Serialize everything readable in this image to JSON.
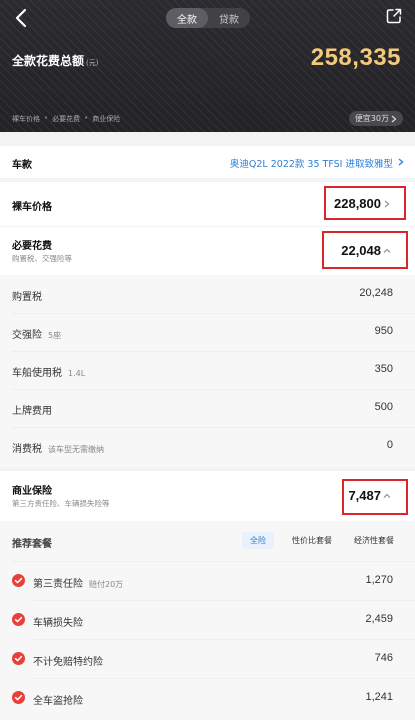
{
  "header": {
    "tabs": [
      {
        "label": "全款",
        "active": true
      },
      {
        "label": "贷款",
        "active": false
      }
    ],
    "total_label": "全款花费总额",
    "total_unit": "(元)",
    "total_value": "258,335",
    "breakdown": [
      "裸车价格",
      "必要花费",
      "商业保险"
    ],
    "budget_button": "便宜30万"
  },
  "model": {
    "label": "车款",
    "value": "奥迪Q2L 2022款 35 TFSI 进取致雅型"
  },
  "car_price": {
    "label": "裸车价格",
    "value": "228,800"
  },
  "required": {
    "label": "必要花费",
    "sub": "购置税、交强险等",
    "value": "22,048",
    "items": [
      {
        "label": "购置税",
        "note": "",
        "value": "20,248"
      },
      {
        "label": "交强险",
        "note": "5座",
        "value": "950"
      },
      {
        "label": "车船使用税",
        "note": "1.4L",
        "value": "350"
      },
      {
        "label": "上牌费用",
        "note": "",
        "value": "500"
      },
      {
        "label": "消费税",
        "note": "该车型无需缴纳",
        "value": "0"
      }
    ]
  },
  "insurance": {
    "label": "商业保险",
    "sub": "第三方责任险、车辆损失险等",
    "value": "7,487",
    "plans_label": "推荐套餐",
    "plans": [
      {
        "label": "全险",
        "active": true
      },
      {
        "label": "性价比套餐",
        "active": false
      },
      {
        "label": "经济性套餐",
        "active": false
      }
    ],
    "items": [
      {
        "label": "第三责任险",
        "note": "赔付20万",
        "value": "1,270",
        "checked": true
      },
      {
        "label": "车辆损失险",
        "note": "",
        "value": "2,459",
        "checked": true
      },
      {
        "label": "不计免赔特约险",
        "note": "",
        "value": "746",
        "checked": true
      },
      {
        "label": "全车盗抢险",
        "note": "",
        "value": "1,241",
        "checked": true
      }
    ]
  },
  "colors": {
    "accent_gold": "#f3c97c",
    "link_blue": "#2f7fd6",
    "check_red": "#e8413a",
    "highlight_red": "#d9262b"
  }
}
